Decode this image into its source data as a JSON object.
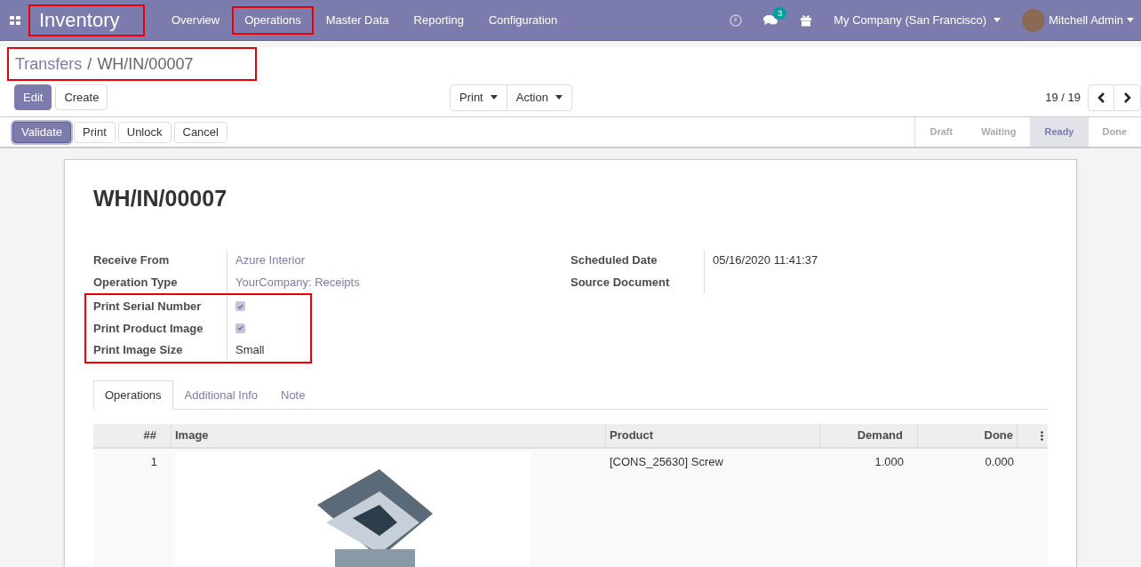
{
  "navbar": {
    "app_name": "Inventory",
    "app_name_annotated": true,
    "menu": [
      {
        "label": "Overview",
        "annotated": false
      },
      {
        "label": "Operations",
        "annotated": true
      },
      {
        "label": "Master Data",
        "annotated": false
      },
      {
        "label": "Reporting",
        "annotated": false
      },
      {
        "label": "Configuration",
        "annotated": false
      }
    ],
    "messages_badge": "3",
    "company": "My Company (San Francisco)",
    "user": "Mitchell Admin"
  },
  "breadcrumb": {
    "annotated": true,
    "separator": "/",
    "items": [
      "Transfers",
      "WH/IN/00007"
    ]
  },
  "buttons": [
    "Edit",
    "Create"
  ],
  "dropdowns": [
    "Print",
    "Action"
  ],
  "pager": "19 / 19",
  "action_buttons": [
    "Validate",
    "Print",
    "Unlock",
    "Cancel"
  ],
  "status_steps": [
    {
      "label": "Draft",
      "selected": false
    },
    {
      "label": "Waiting",
      "selected": false
    },
    {
      "label": "Ready",
      "selected": true
    },
    {
      "label": "Done",
      "selected": false
    }
  ],
  "record": {
    "title": "WH/IN/00007",
    "left_fields": [
      {
        "label": "Receive From",
        "kind": "link",
        "value": "Azure Interior",
        "annotated": false
      },
      {
        "label": "Operation Type",
        "kind": "link",
        "value": "YourCompany: Receipts",
        "annotated": false
      },
      {
        "label": "Print Serial Number",
        "kind": "checkbox",
        "checked": true,
        "annotated": true
      },
      {
        "label": "Print Product Image",
        "kind": "checkbox",
        "checked": true,
        "annotated": true
      },
      {
        "label": "Print Image Size",
        "kind": "text",
        "value": "Small",
        "annotated": true
      }
    ],
    "right_fields": [
      {
        "label": "Scheduled Date",
        "kind": "text",
        "value": "05/16/2020 11:41:37"
      },
      {
        "label": "Source Document",
        "kind": "text"
      }
    ],
    "tabs": [
      {
        "label": "Operations",
        "selected": true
      },
      {
        "label": "Additional Info",
        "selected": false
      },
      {
        "label": "Note",
        "selected": false
      }
    ],
    "table": {
      "columns": [
        "##",
        "Image",
        "Product",
        "Demand",
        "Done"
      ],
      "rows": [
        {
          "number": "1",
          "product": "[CONS_25630] Screw",
          "demand": "1.000",
          "done": "0.000"
        }
      ]
    }
  }
}
